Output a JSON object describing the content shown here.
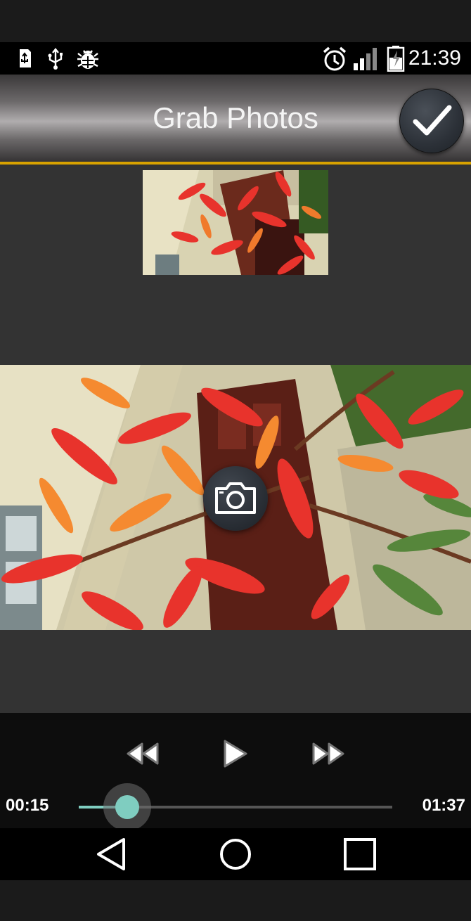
{
  "status_bar": {
    "time": "21:39",
    "left_icons": [
      "usb-storage-icon",
      "usb-icon",
      "debug-bug-icon"
    ],
    "right_icons": [
      "alarm-icon",
      "signal-icon",
      "battery-charging-icon"
    ]
  },
  "action_bar": {
    "title": "Grab Photos",
    "done_icon": "checkmark-icon",
    "accent_color": "#d8a200"
  },
  "thumbnail": {
    "description_icon": "captured-frame-thumbnail"
  },
  "preview": {
    "capture_icon": "camera-icon"
  },
  "playback": {
    "current_time": "00:15",
    "total_time": "01:37",
    "progress_fraction": 0.155,
    "seek_color": "#7fcdc0",
    "buttons": [
      "rewind-icon",
      "play-icon",
      "fast-forward-icon"
    ]
  },
  "nav_bar": {
    "buttons": [
      "back-icon",
      "home-icon",
      "recents-icon"
    ]
  }
}
